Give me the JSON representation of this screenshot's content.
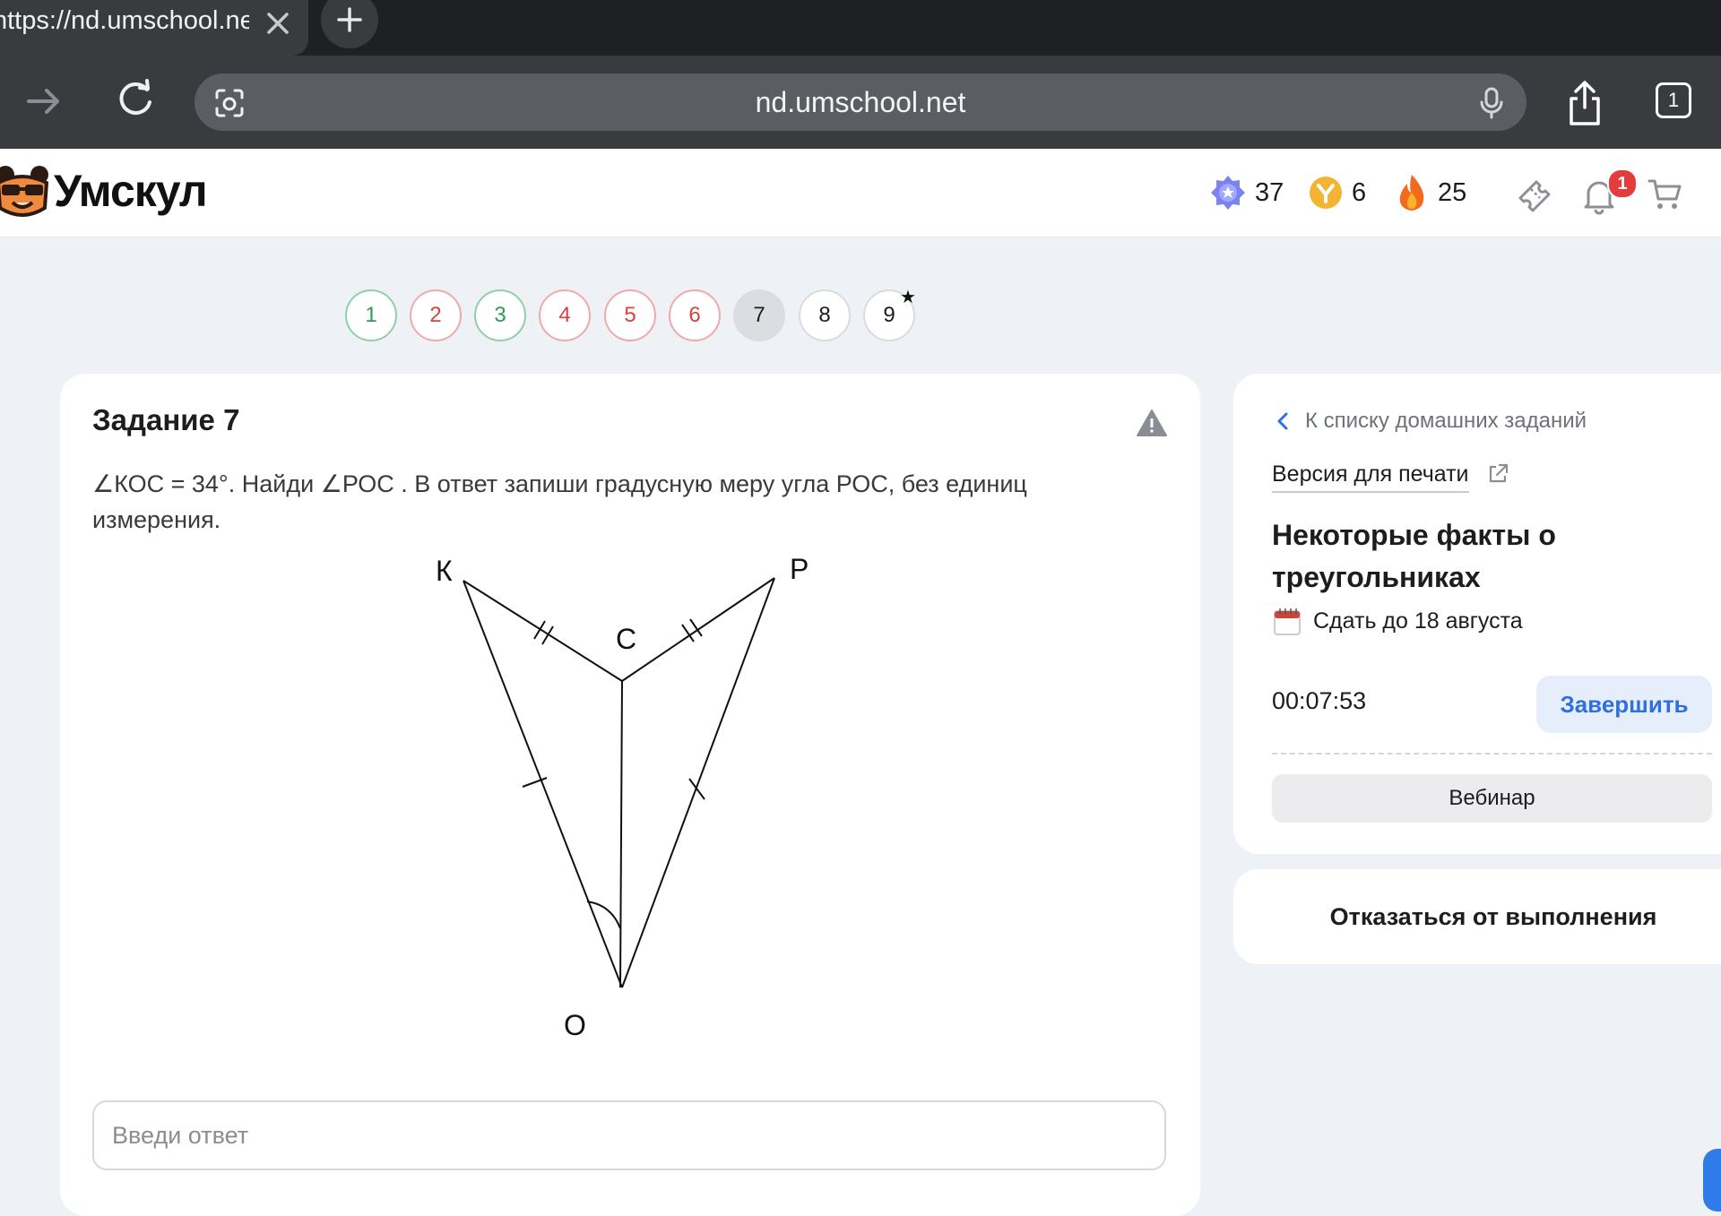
{
  "browser": {
    "tab_title": "https://nd.umschool.net/",
    "url": "nd.umschool.net",
    "tab_count": "1",
    "icons": [
      "close-icon",
      "plus-icon",
      "forward-icon",
      "reload-icon",
      "lens-icon",
      "mic-icon",
      "share-icon",
      "tabs-icon"
    ]
  },
  "header": {
    "logo_text": "Умскул",
    "stats": {
      "badges": "37",
      "coins": "6",
      "streak": "25"
    },
    "notification_count": "1"
  },
  "task_nav": [
    {
      "label": "1",
      "status": "correct"
    },
    {
      "label": "2",
      "status": "wrong"
    },
    {
      "label": "3",
      "status": "correct"
    },
    {
      "label": "4",
      "status": "wrong"
    },
    {
      "label": "5",
      "status": "wrong"
    },
    {
      "label": "6",
      "status": "wrong"
    },
    {
      "label": "7",
      "status": "current"
    },
    {
      "label": "8",
      "status": "pending"
    },
    {
      "label": "9",
      "status": "pending",
      "starred": true
    }
  ],
  "task": {
    "title": "Задание 7",
    "text_line1": "∠КОС = 34°. Найди ∠РОС . В ответ запиши градусную меру угла РОС, без единиц",
    "text_line2": "измерения.",
    "figure": {
      "labels": {
        "K": "К",
        "P": "Р",
        "C": "С",
        "O": "О"
      }
    },
    "answer_placeholder": "Введи ответ"
  },
  "sidebar": {
    "back_label": "К списку домашних заданий",
    "print_label": "Версия для печати",
    "homework_title": "Некоторые факты о треугольниках",
    "deadline": "Сдать до 18 августа",
    "timer": "00:07:53",
    "finish_label": "Завершить",
    "webinar_label": "Вебинар",
    "refuse_label": "Отказаться от выполнения"
  },
  "colors": {
    "accent": "#2f6fde",
    "correct": "#2e9a55",
    "wrong": "#d94040",
    "page_bg": "#eef2f7"
  }
}
